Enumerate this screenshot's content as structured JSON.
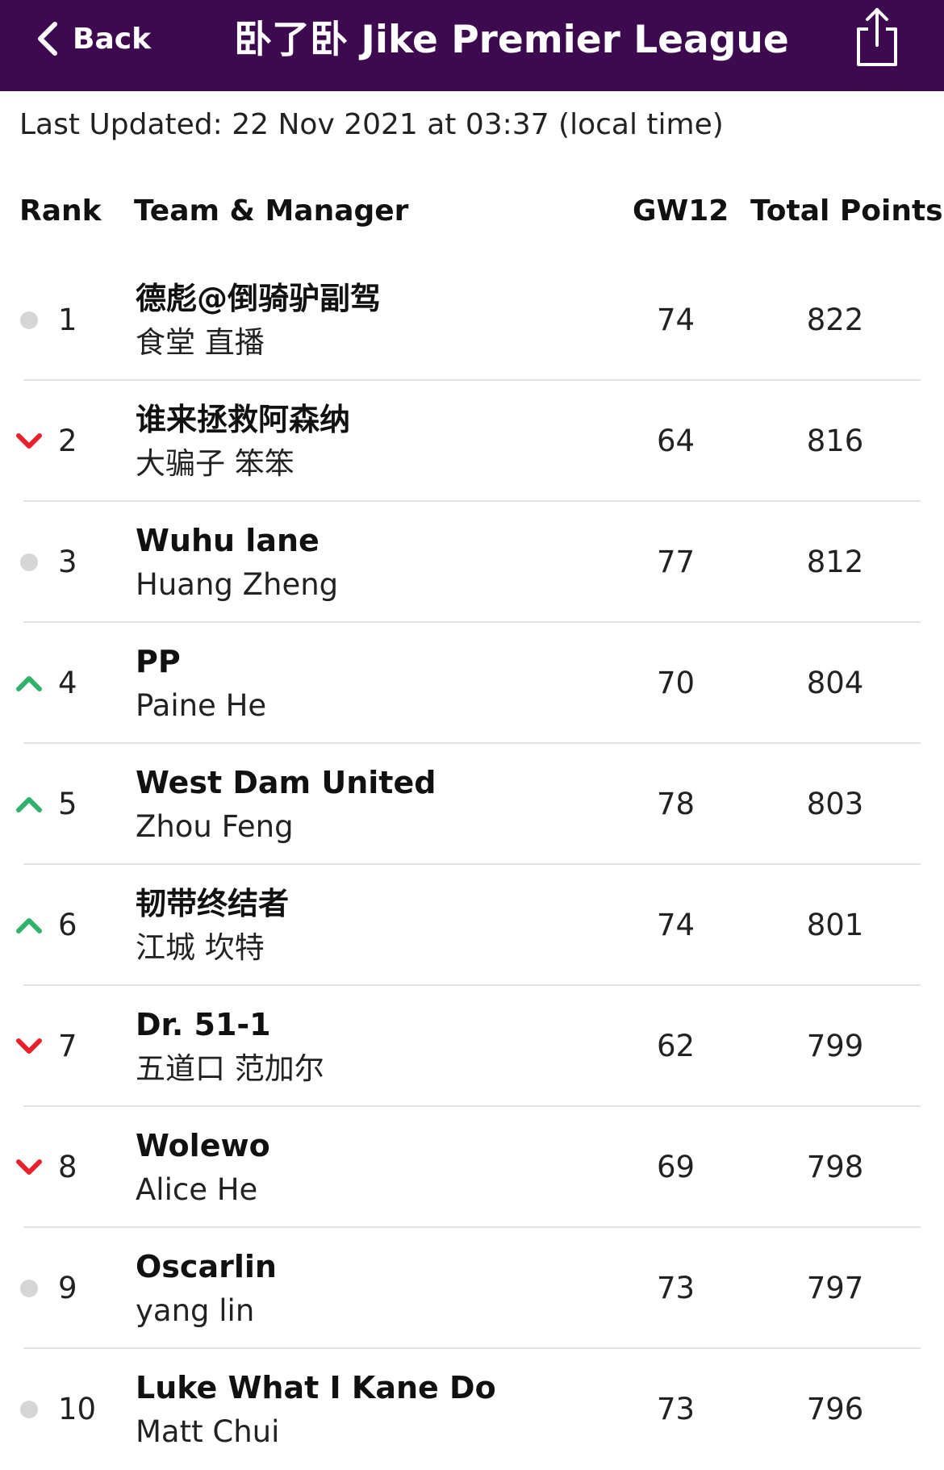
{
  "nav": {
    "back_label": "Back",
    "title": "卧了卧 Jike Premier League",
    "back_icon": "chevron-left-icon",
    "share_icon": "share-icon"
  },
  "last_updated": "Last Updated: 22 Nov 2021 at 03:37 (local time)",
  "table": {
    "headers": {
      "rank": "Rank",
      "team_manager": "Team & Manager",
      "gameweek": "GW12",
      "total": "Total Points"
    },
    "rows": [
      {
        "movement": "same",
        "rank": "1",
        "team": "德彪@倒骑驴副驾",
        "manager": "食堂 直播",
        "gw": "74",
        "total": "822"
      },
      {
        "movement": "down",
        "rank": "2",
        "team": "谁来拯救阿森纳",
        "manager": "大骗子 笨笨",
        "gw": "64",
        "total": "816"
      },
      {
        "movement": "same",
        "rank": "3",
        "team": "Wuhu lane",
        "manager": "Huang Zheng",
        "gw": "77",
        "total": "812"
      },
      {
        "movement": "up",
        "rank": "4",
        "team": "PP",
        "manager": "Paine He",
        "gw": "70",
        "total": "804"
      },
      {
        "movement": "up",
        "rank": "5",
        "team": "West Dam United",
        "manager": "Zhou Feng",
        "gw": "78",
        "total": "803"
      },
      {
        "movement": "up",
        "rank": "6",
        "team": "韧带终结者",
        "manager": "江城 坎特",
        "gw": "74",
        "total": "801"
      },
      {
        "movement": "down",
        "rank": "7",
        "team": "Dr. 51-1",
        "manager": "五道口 范加尔",
        "gw": "62",
        "total": "799"
      },
      {
        "movement": "down",
        "rank": "8",
        "team": "Wolewo",
        "manager": "Alice He",
        "gw": "69",
        "total": "798"
      },
      {
        "movement": "same",
        "rank": "9",
        "team": "Oscarlin",
        "manager": "yang lin",
        "gw": "73",
        "total": "797"
      },
      {
        "movement": "same",
        "rank": "10",
        "team": "Luke What I Kane Do",
        "manager": "Matt Chui",
        "gw": "73",
        "total": "796"
      }
    ]
  },
  "colors": {
    "header_bg": "#3d0a4f",
    "up": "#2fb36c",
    "down": "#e8212b",
    "same": "#d6d6d6"
  }
}
